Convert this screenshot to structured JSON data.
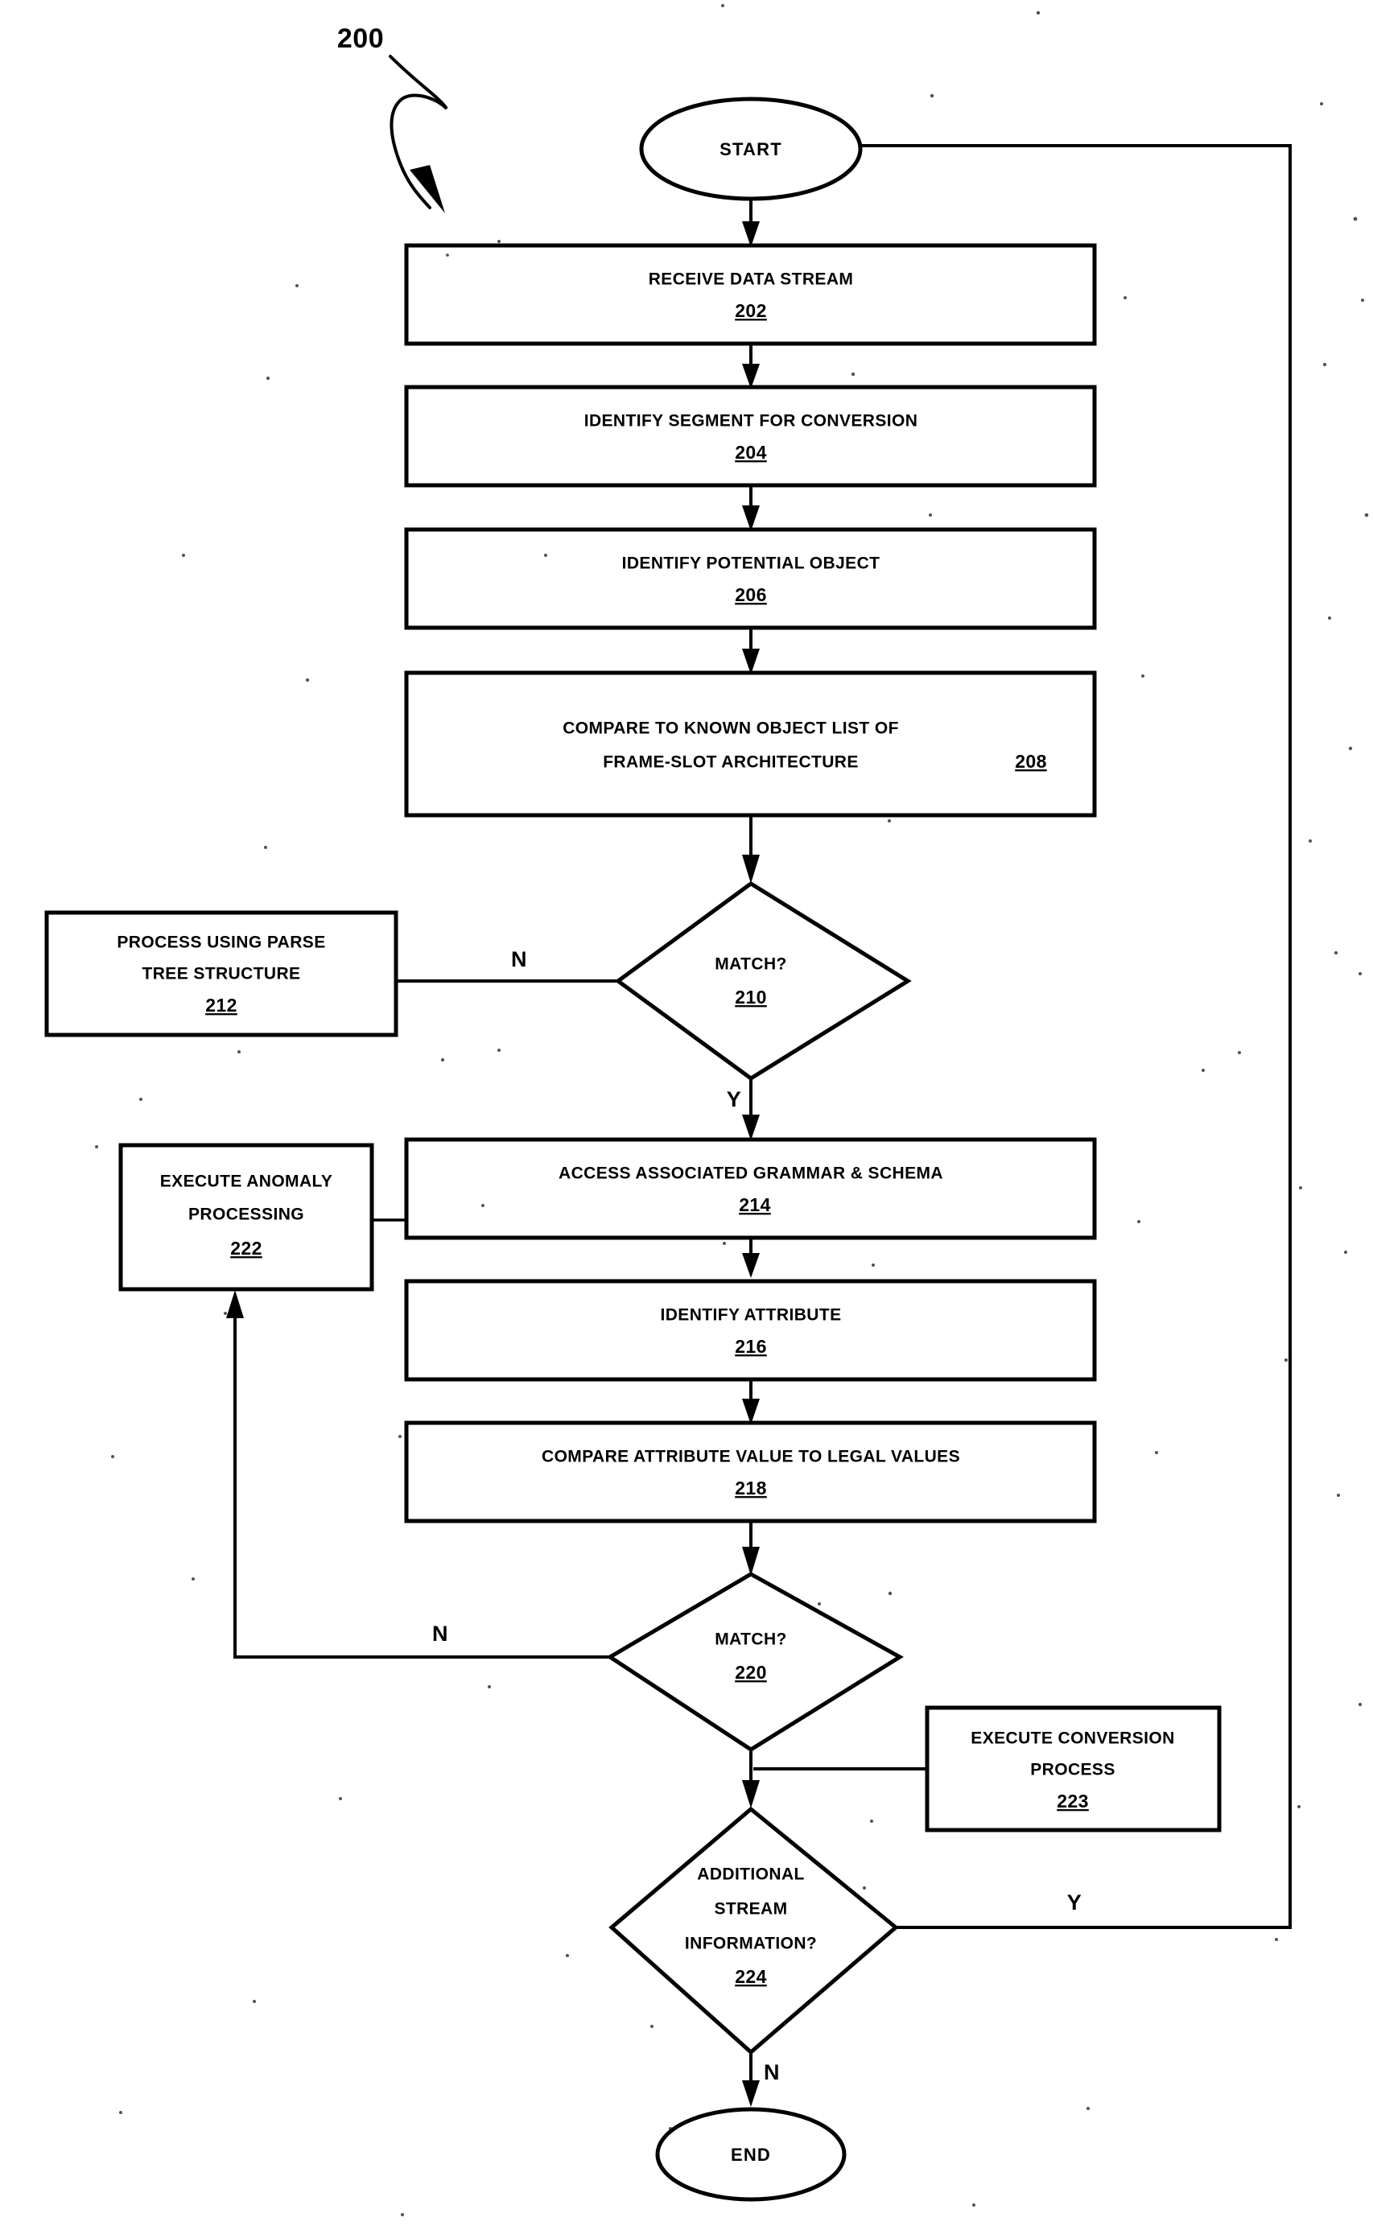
{
  "figure": {
    "number": "200",
    "lead_arrow": "curved-lead-line"
  },
  "nodes": {
    "start": {
      "label": "START",
      "shape": "terminator"
    },
    "end": {
      "label": "END",
      "shape": "terminator"
    },
    "s202": {
      "line1": "RECEIVE DATA STREAM",
      "line2": "",
      "number": "202",
      "shape": "process"
    },
    "s204": {
      "line1": "IDENTIFY SEGMENT FOR CONVERSION",
      "line2": "",
      "number": "204",
      "shape": "process"
    },
    "s206": {
      "line1": "IDENTIFY POTENTIAL OBJECT",
      "line2": "",
      "number": "206",
      "shape": "process"
    },
    "s208": {
      "line1": "COMPARE TO KNOWN OBJECT LIST OF",
      "line2": "FRAME-SLOT ARCHITECTURE",
      "number": "208",
      "shape": "process"
    },
    "d210": {
      "line1": "MATCH?",
      "number": "210",
      "shape": "decision"
    },
    "s212": {
      "line1": "PROCESS USING PARSE",
      "line2": "TREE STRUCTURE",
      "number": "212",
      "shape": "process"
    },
    "s214": {
      "line1": "ACCESS ASSOCIATED GRAMMAR & SCHEMA",
      "line2": "",
      "number": "214",
      "shape": "process"
    },
    "s216": {
      "line1": "IDENTIFY ATTRIBUTE",
      "line2": "",
      "number": "216",
      "shape": "process"
    },
    "s218": {
      "line1": "COMPARE ATTRIBUTE VALUE TO LEGAL VALUES",
      "line2": "",
      "number": "218",
      "shape": "process"
    },
    "d220": {
      "line1": "MATCH?",
      "number": "220",
      "shape": "decision"
    },
    "s222": {
      "line1": "EXECUTE ANOMALY",
      "line2": "PROCESSING",
      "number": "222",
      "shape": "process"
    },
    "s223": {
      "line1": "EXECUTE CONVERSION",
      "line2": "PROCESS",
      "number": "223",
      "shape": "process"
    },
    "d224": {
      "line1": "ADDITIONAL",
      "line2": "STREAM",
      "line3": "INFORMATION?",
      "number": "224",
      "shape": "decision"
    }
  },
  "branch_labels": {
    "d210_no": "N",
    "d210_yes": "Y",
    "d220_no": "N",
    "d224_yes": "Y",
    "d224_no": "N"
  },
  "colors": {
    "ink": "#000000",
    "paper": "#ffffff"
  }
}
